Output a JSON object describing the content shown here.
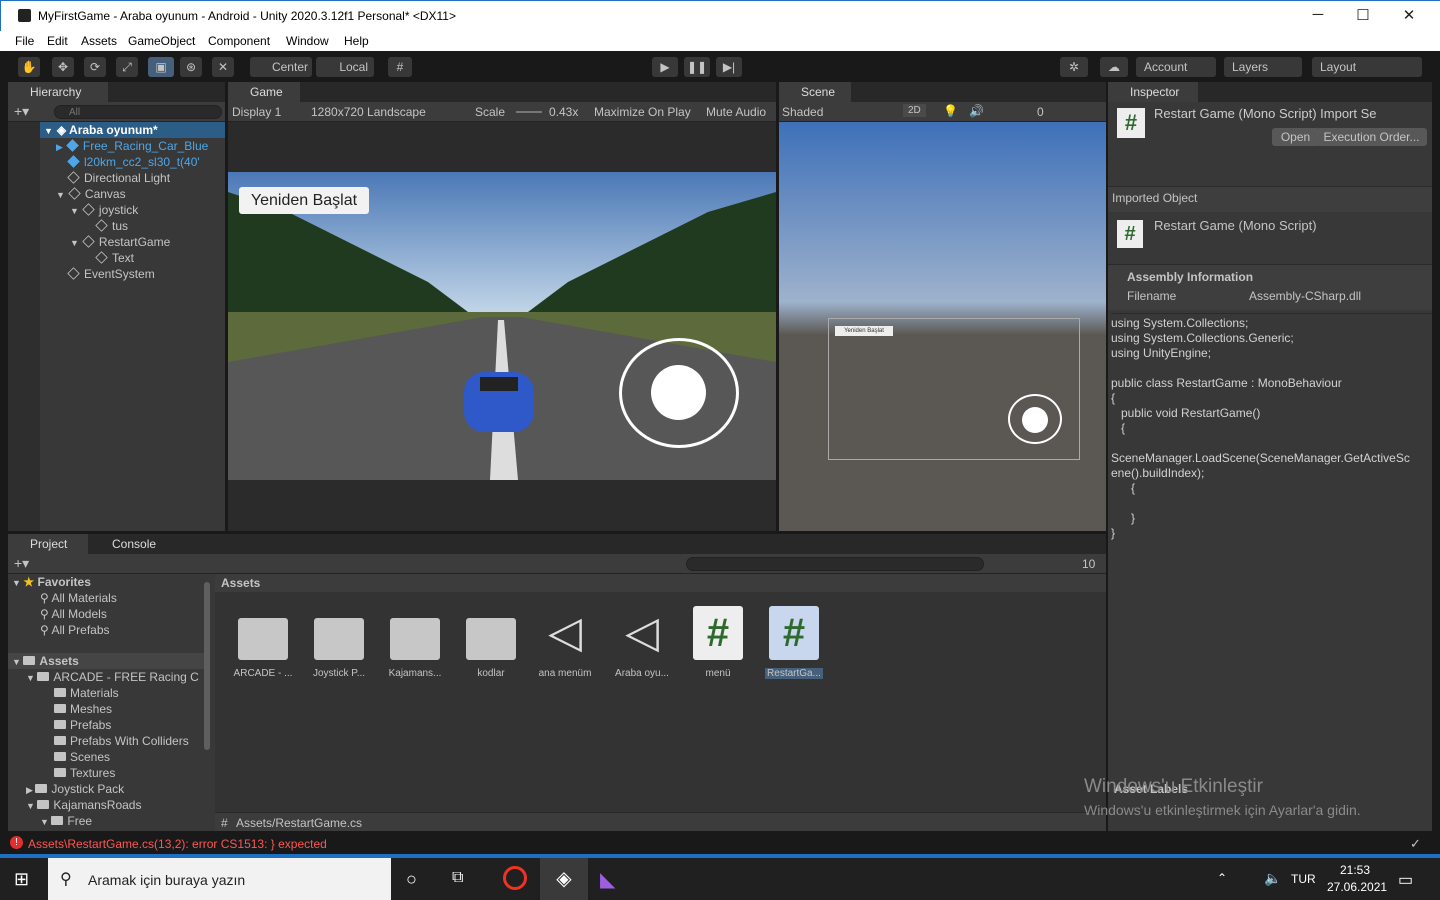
{
  "window": {
    "title": "MyFirstGame - Araba oyunum - Android - Unity 2020.3.12f1 Personal* <DX11>",
    "minimize": "─",
    "maximize": "☐",
    "close": "✕"
  },
  "menu": [
    "File",
    "Edit",
    "Assets",
    "GameObject",
    "Component",
    "Window",
    "Help"
  ],
  "toolbar": {
    "center": "Center",
    "local": "Local",
    "account": "Account",
    "layers": "Layers",
    "layout": "Layout"
  },
  "hierarchy": {
    "tab": "Hierarchy",
    "search_placeholder": "All",
    "scene": "Araba oyunum*",
    "items": [
      "Free_Racing_Car_Blue",
      "l20km_cc2_sl30_t(40'",
      "Directional Light",
      "Canvas",
      "joystick",
      "tus",
      "RestartGame",
      "Text",
      "EventSystem"
    ]
  },
  "game": {
    "tab": "Game",
    "display": "Display 1",
    "resolution": "1280x720 Landscape",
    "scale_label": "Scale",
    "scale_value": "0.43x",
    "maximize": "Maximize On Play",
    "mute": "Mute Audio",
    "restart_button": "Yeniden Başlat"
  },
  "scene": {
    "tab": "Scene",
    "mode": "Shaded",
    "twod": "2D",
    "hidden_count": "0",
    "restart_label": "Yeniden Başlat"
  },
  "inspector": {
    "tab": "Inspector",
    "header": "Restart Game (Mono Script) Import Se",
    "open": "Open",
    "exec_order": "Execution Order...",
    "imported": "Imported Object",
    "script_name": "Restart Game (Mono Script)",
    "assembly_heading": "Assembly Information",
    "filename_label": "Filename",
    "filename_value": "Assembly-CSharp.dll",
    "asset_labels": "Asset Labels",
    "code": "using System.Collections;\nusing System.Collections.Generic;\nusing UnityEngine;\n\npublic class RestartGame : MonoBehaviour\n{\n   public void RestartGame()\n   {\n\nSceneManager.LoadScene(SceneManager.GetActiveSc\nene().buildIndex);\n      {\n\n      }\n}"
  },
  "project": {
    "tab_project": "Project",
    "tab_console": "Console",
    "hidden_count": "10",
    "favorites": "Favorites",
    "fav_items": [
      "All Materials",
      "All Models",
      "All Prefabs"
    ],
    "assets_root": "Assets",
    "tree": [
      "ARCADE - FREE Racing C",
      "Materials",
      "Meshes",
      "Prefabs",
      "Prefabs With Colliders",
      "Scenes",
      "Textures",
      "Joystick Pack",
      "KajamansRoads",
      "Free"
    ],
    "breadcrumb": "Assets",
    "path": "Assets/RestartGame.cs",
    "assets": [
      "ARCADE - ...",
      "Joystick P...",
      "Kajamans...",
      "kodlar",
      "ana menüm",
      "Araba oyu...",
      "menü",
      "RestartGa..."
    ]
  },
  "status": {
    "error": "Assets\\RestartGame.cs(13,2): error CS1513: } expected"
  },
  "watermark": {
    "line1": "Windows'u Etkinleştir",
    "line2": "Windows'u etkinleştirmek için Ayarlar'a gidin."
  },
  "taskbar": {
    "search": "Aramak için buraya yazın",
    "lang": "TUR",
    "time": "21:53",
    "date": "27.06.2021"
  },
  "colors": {
    "accent": "#46607c",
    "error": "#ff5555",
    "link": "#4ea6e8"
  }
}
